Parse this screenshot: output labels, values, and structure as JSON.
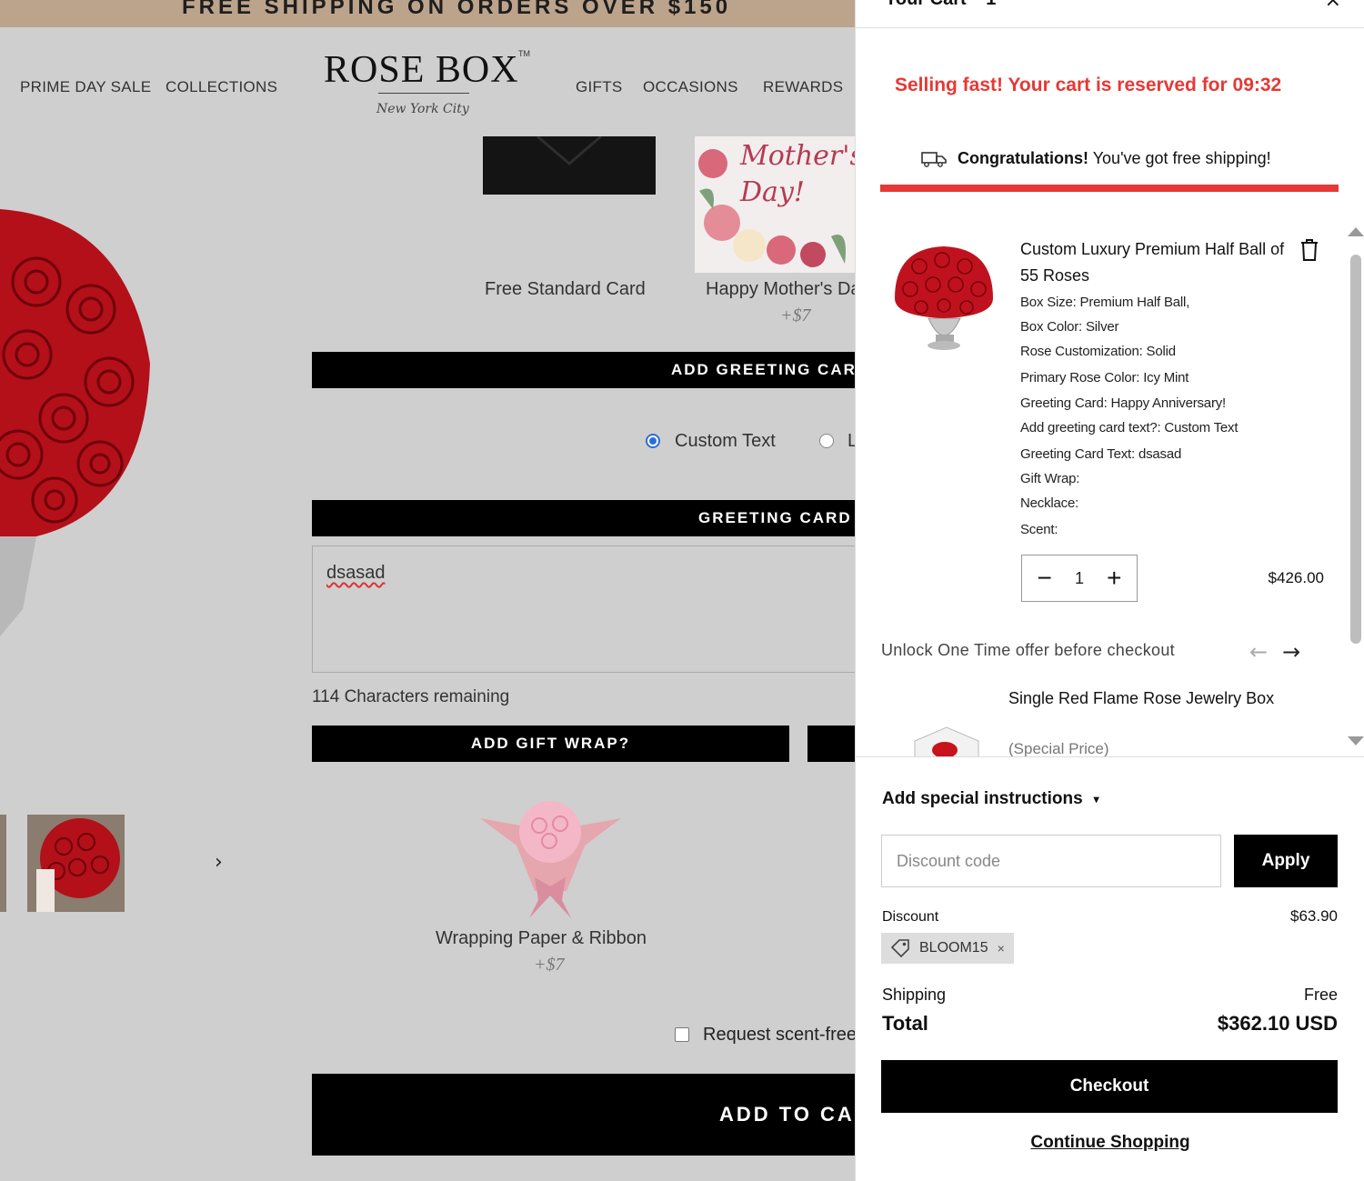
{
  "background_page": {
    "promo_text": "FREE SHIPPING ON ORDERS OVER $150",
    "nav_left": [
      "PRIME DAY SALE",
      "COLLECTIONS"
    ],
    "nav_right": [
      "GIFTS",
      "OCCASIONS",
      "REWARDS"
    ],
    "logo": {
      "main": "ROSE BOX",
      "tm": "TM",
      "sub": "New York City"
    },
    "cards": [
      {
        "label": "Free Standard Card",
        "price": ""
      },
      {
        "label": "Happy Mother's Day",
        "price": "+$7",
        "card_text": "Mother's Day!"
      }
    ],
    "add_greeting_card_bar": "ADD GREETING CARD",
    "radio_options": [
      {
        "label": "Custom Text",
        "selected": true
      },
      {
        "label": "L",
        "selected": false
      }
    ],
    "greeting_card_bar": "GREETING CARD",
    "greeting_text_value": "dsasad",
    "chars_remaining": "114 Characters remaining",
    "gift_wrap_bar": "ADD GIFT WRAP?",
    "wrap_option": {
      "label": "Wrapping Paper & Ribbon",
      "price": "+$7"
    },
    "scent_checkbox_label": "Request scent-free",
    "add_to_cart": "ADD TO CART",
    "thumbnail_next": "›"
  },
  "cart": {
    "title": "Your Cart",
    "count": "1",
    "close_icon": "×",
    "urgency_message": "Selling fast! Your cart is reserved for 09:32",
    "shipping_message_bold": "Congratulations!",
    "shipping_message_rest": "You've got free shipping!",
    "free_shipping_progress": 1.0,
    "accent_color": "#e53935",
    "item": {
      "name": "Custom Luxury Premium Half Ball of 55 Roses",
      "options": [
        "Box Size: Premium Half Ball,",
        "Box Color: Silver",
        "Rose Customization: Solid",
        "Primary Rose Color: Icy Mint",
        "Greeting Card: Happy Anniversary!",
        "Add greeting card text?: Custom Text",
        "Greeting Card Text: dsasad",
        "Gift Wrap:",
        "Necklace:",
        "Scent:"
      ],
      "quantity": "1",
      "minus": "−",
      "plus": "+",
      "price": "$426.00"
    },
    "offer": {
      "title": "Unlock One Time offer before checkout",
      "prev": "←",
      "next": "→",
      "product_name": "Single Red Flame Rose Jewelry Box",
      "product_sub": "(Special Price)"
    },
    "instructions_label": "Add special instructions",
    "instructions_caret": "▾",
    "discount_placeholder": "Discount code",
    "apply_label": "Apply",
    "discount_label": "Discount",
    "discount_value": "$63.90",
    "discount_tag": "BLOOM15",
    "discount_tag_remove": "×",
    "shipping_label": "Shipping",
    "shipping_value": "Free",
    "total_label": "Total",
    "total_value": "$362.10 USD",
    "checkout_label": "Checkout",
    "continue_label": "Continue Shopping"
  }
}
